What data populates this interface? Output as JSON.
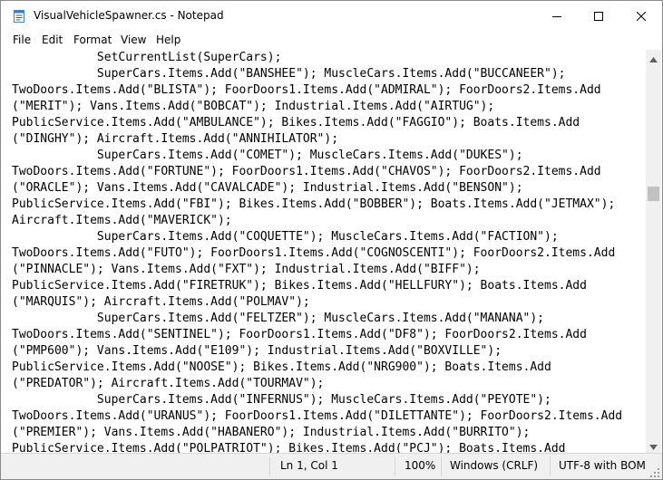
{
  "window": {
    "title": "VisualVehicleSpawner.cs - Notepad"
  },
  "menu": {
    "items": [
      "File",
      "Edit",
      "Format",
      "View",
      "Help"
    ]
  },
  "editor": {
    "lines": [
      "            SetCurrentList(SuperCars);",
      "            SuperCars.Items.Add(\"BANSHEE\"); MuscleCars.Items.Add(\"BUCCANEER\");",
      "TwoDoors.Items.Add(\"BLISTA\"); FoorDoors1.Items.Add(\"ADMIRAL\"); FoorDoors2.Items.Add",
      "(\"MERIT\"); Vans.Items.Add(\"BOBCAT\"); Industrial.Items.Add(\"AIRTUG\");",
      "PublicService.Items.Add(\"AMBULANCE\"); Bikes.Items.Add(\"FAGGIO\"); Boats.Items.Add",
      "(\"DINGHY\"); Aircraft.Items.Add(\"ANNIHILATOR\");",
      "            SuperCars.Items.Add(\"COMET\"); MuscleCars.Items.Add(\"DUKES\");",
      "TwoDoors.Items.Add(\"FORTUNE\"); FoorDoors1.Items.Add(\"CHAVOS\"); FoorDoors2.Items.Add",
      "(\"ORACLE\"); Vans.Items.Add(\"CAVALCADE\"); Industrial.Items.Add(\"BENSON\");",
      "PublicService.Items.Add(\"FBI\"); Bikes.Items.Add(\"BOBBER\"); Boats.Items.Add(\"JETMAX\");",
      "Aircraft.Items.Add(\"MAVERICK\");",
      "            SuperCars.Items.Add(\"COQUETTE\"); MuscleCars.Items.Add(\"FACTION\");",
      "TwoDoors.Items.Add(\"FUTO\"); FoorDoors1.Items.Add(\"COGNOSCENTI\"); FoorDoors2.Items.Add",
      "(\"PINNACLE\"); Vans.Items.Add(\"FXT\"); Industrial.Items.Add(\"BIFF\");",
      "PublicService.Items.Add(\"FIRETRUK\"); Bikes.Items.Add(\"HELLFURY\"); Boats.Items.Add",
      "(\"MARQUIS\"); Aircraft.Items.Add(\"POLMAV\");",
      "            SuperCars.Items.Add(\"FELTZER\"); MuscleCars.Items.Add(\"MANANA\");",
      "TwoDoors.Items.Add(\"SENTINEL\"); FoorDoors1.Items.Add(\"DF8\"); FoorDoors2.Items.Add",
      "(\"PMP600\"); Vans.Items.Add(\"E109\"); Industrial.Items.Add(\"BOXVILLE\");",
      "PublicService.Items.Add(\"NOOSE\"); Bikes.Items.Add(\"NRG900\"); Boats.Items.Add",
      "(\"PREDATOR\"); Aircraft.Items.Add(\"TOURMAV\");",
      "            SuperCars.Items.Add(\"INFERNUS\"); MuscleCars.Items.Add(\"PEYOTE\");",
      "TwoDoors.Items.Add(\"URANUS\"); FoorDoors1.Items.Add(\"DILETTANTE\"); FoorDoors2.Items.Add",
      "(\"PREMIER\"); Vans.Items.Add(\"HABANERO\"); Industrial.Items.Add(\"BURRITO\");",
      "PublicService.Items.Add(\"POLPATRIOT\"); Bikes.Items.Add(\"PCJ\"); Boats.Items.Add"
    ]
  },
  "status": {
    "position": "Ln 1, Col 1",
    "zoom": "100%",
    "line_ending": "Windows (CRLF)",
    "encoding": "UTF-8 with BOM"
  },
  "icons": {
    "app": "notepad-icon",
    "minimize": "minimize-icon",
    "maximize": "maximize-icon",
    "close": "close-icon",
    "scroll_up": "chevron-up-icon",
    "scroll_down": "chevron-down-icon",
    "grip": "resize-grip-icon"
  },
  "colors": {
    "status_bar": "#f0f0f0",
    "scroll_thumb": "#c1c1c1"
  }
}
